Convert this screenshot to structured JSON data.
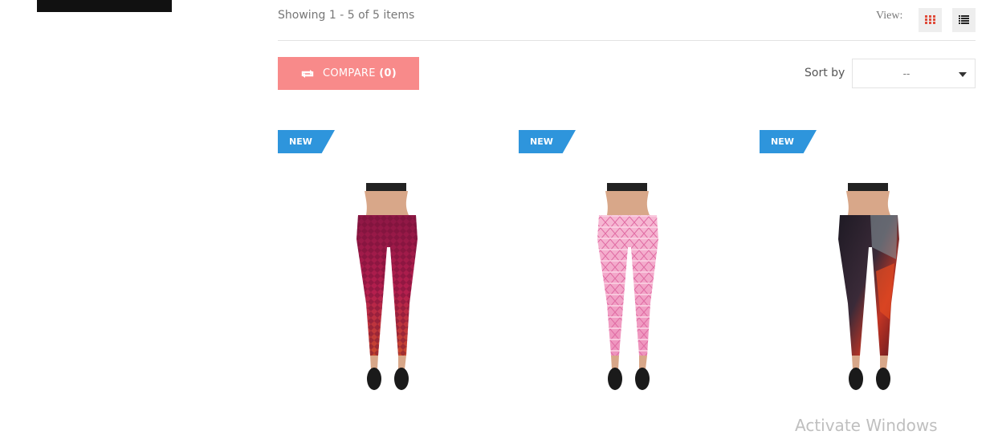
{
  "toolbar": {
    "count_text": "Showing 1 - 5 of 5 items",
    "view_label": "View:",
    "view_modes": [
      {
        "name": "grid",
        "icon": "grid-icon",
        "active": true,
        "color": "#e04b3a"
      },
      {
        "name": "list",
        "icon": "list-icon",
        "active": false,
        "color": "#222222"
      }
    ]
  },
  "compare": {
    "label": "COMPARE",
    "count": "(0)",
    "icon": "refresh-arrows-icon",
    "color": "#f88a8a"
  },
  "sort": {
    "label": "Sort by",
    "value": "--"
  },
  "products": [
    {
      "badge": "NEW",
      "pattern": "magenta-geometric",
      "colors": [
        "#a01a4c",
        "#c42a56",
        "#c4452f"
      ]
    },
    {
      "badge": "NEW",
      "pattern": "pink-tribal",
      "colors": [
        "#f3a5c9",
        "#e87fb0",
        "#f7c4da"
      ]
    },
    {
      "badge": "NEW",
      "pattern": "dark-red-abstract",
      "colors": [
        "#1f1a22",
        "#7a2530",
        "#e0401f"
      ]
    }
  ],
  "badge_color": "#2e95dc",
  "watermark": "Activate Windows"
}
